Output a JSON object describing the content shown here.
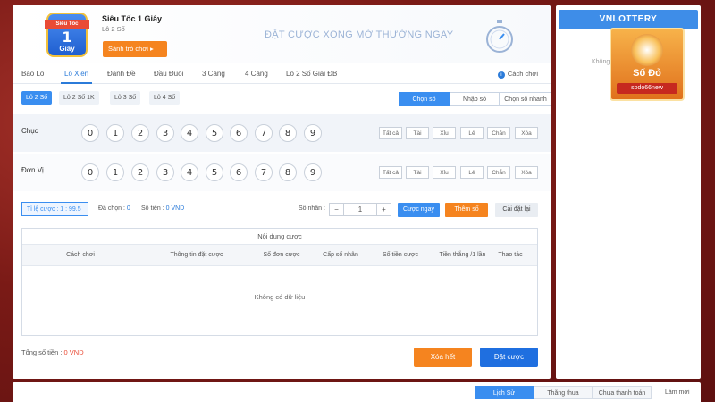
{
  "header": {
    "game_icon_ribbon": "Siêu Tốc",
    "game_icon_number": "1",
    "game_icon_unit": "Giây",
    "title": "Siêu Tốc 1 Giây",
    "subtitle": "Lô 2 Số",
    "lobby_button": "Sảnh trò chơi",
    "banner": "ĐẶT CƯỢC XONG MỞ THƯỞNG NGAY"
  },
  "tabs": [
    {
      "label": "Bao Lô"
    },
    {
      "label": "Lô Xiên"
    },
    {
      "label": "Đánh Đề"
    },
    {
      "label": "Đầu Đuôi"
    },
    {
      "label": "3 Càng"
    },
    {
      "label": "4 Càng"
    },
    {
      "label": "Lô 2 Số Giải ĐB"
    }
  ],
  "how_to_play": "Cách chơi",
  "subtabs": [
    {
      "label": "Lô 2 Số"
    },
    {
      "label": "Lô 2 Số 1K"
    },
    {
      "label": "Lô 3 Số"
    },
    {
      "label": "Lô 4 Số"
    }
  ],
  "modes": [
    {
      "label": "Chọn số"
    },
    {
      "label": "Nhập số"
    },
    {
      "label": "Chọn số nhanh"
    }
  ],
  "rows": [
    {
      "label": "Chục"
    },
    {
      "label": "Đơn Vị"
    }
  ],
  "digits": [
    "0",
    "1",
    "2",
    "3",
    "4",
    "5",
    "6",
    "7",
    "8",
    "9"
  ],
  "filters": [
    "Tất cả",
    "Tài",
    "Xỉu",
    "Lẻ",
    "Chẵn",
    "Xóa"
  ],
  "controls": {
    "rate": "Tỉ lệ cược : 1 : 99.5",
    "selected_label": "Đã chọn :",
    "selected_value": "0",
    "amount_label": "Số tiền :",
    "amount_value": "0 VND",
    "multiplier_label": "Số nhân :",
    "multiplier_value": "1",
    "minus": "−",
    "plus": "+",
    "bet_now": "Cược ngay",
    "add_number": "Thêm số",
    "reset": "Cài đặt lại"
  },
  "table": {
    "title": "Nội dung cược",
    "columns": [
      "Cách chơi",
      "Thông tin đặt cược",
      "Số đơn cược",
      "Cấp số nhân",
      "Số tiền cược",
      "Tiền thắng /1 lần",
      "Thao tác"
    ],
    "empty": "Không có dữ liệu"
  },
  "footer": {
    "total_label": "Tổng số tiền :",
    "total_value": "0 VND",
    "clear_all": "Xóa hết",
    "place_bet": "Đặt cược"
  },
  "side": {
    "brand": "VNLOTTERY",
    "empty": "Không có dữ liệu",
    "promo_brand": "Số Đỏ",
    "promo_code": "sodo66new"
  },
  "bottom_tabs": [
    {
      "label": "Lịch Sử"
    },
    {
      "label": "Thắng thua"
    },
    {
      "label": "Chưa thanh toán"
    }
  ],
  "refresh": "Làm mới",
  "colors": {
    "accent": "#3a8ef0",
    "orange": "#f5841f",
    "danger": "#e94b35"
  }
}
